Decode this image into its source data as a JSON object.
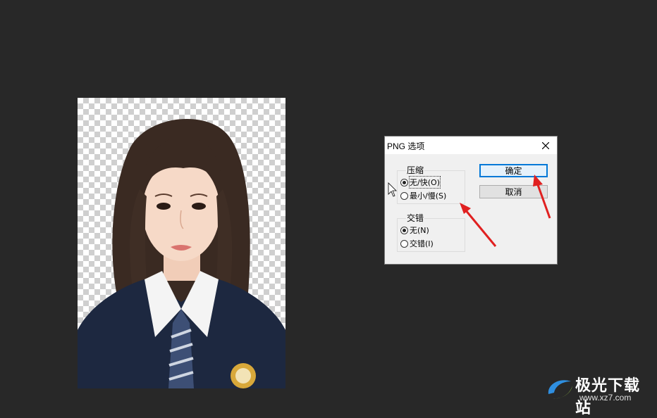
{
  "dialog": {
    "title": "PNG 选项",
    "compression": {
      "label": "压缩",
      "options": [
        {
          "label": "无/快(O)",
          "selected": true
        },
        {
          "label": "最小/慢(S)",
          "selected": false
        }
      ]
    },
    "interlace": {
      "label": "交错",
      "options": [
        {
          "label": "无(N)",
          "selected": true
        },
        {
          "label": "交错(I)",
          "selected": false
        }
      ]
    },
    "ok_label": "确定",
    "cancel_label": "取消"
  },
  "watermark": {
    "brand": "极光下载站",
    "url": "www.xz7.com"
  },
  "colors": {
    "workspace": "#282828",
    "dialog_bg": "#f0f0f0",
    "default_button_border": "#0078d7",
    "annotation_arrow": "#e02020"
  }
}
